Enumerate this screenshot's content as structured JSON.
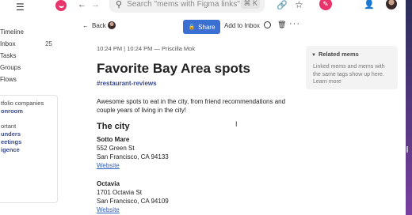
{
  "topbar": {
    "search_placeholder": "Search \"mems with Figma links\"",
    "search_shortcut": "⌘ K"
  },
  "sidebar": {
    "items": [
      {
        "label": "Timeline",
        "count": ""
      },
      {
        "label": "Inbox",
        "count": "25"
      },
      {
        "label": "Tasks",
        "count": ""
      },
      {
        "label": "Groups",
        "count": ""
      },
      {
        "label": "Flows",
        "count": ""
      }
    ],
    "card": {
      "heading": "tfolio companies",
      "lines": [
        "onroom",
        "ortant",
        "unders",
        "eetings",
        "igence"
      ]
    }
  },
  "actionbar": {
    "back_label": "Back",
    "share_label": "Share",
    "add_inbox_label": "Add to Inbox"
  },
  "mem": {
    "meta": "10:24 PM | 10:24 PM — Priscilla Mok",
    "title": "Favorite Bay Area spots",
    "tag": "#restaurant-reviews",
    "description": "Awesome spots to eat in the city, from friend recommendations and couple years of living in the city!",
    "section_heading": "The city",
    "places": [
      {
        "name": "Sotto Mare",
        "street": "552 Green St",
        "city": "San Francisco, CA 94133",
        "link": "Website"
      },
      {
        "name": "Octavia",
        "street": "1701 Octavia St",
        "city": "San Francisco, CA 94109",
        "link": "Website"
      }
    ]
  },
  "related": {
    "heading": "Related mems",
    "body": "Linked mems and mems with the same tags show up here.",
    "learn_more": "Learn more"
  }
}
